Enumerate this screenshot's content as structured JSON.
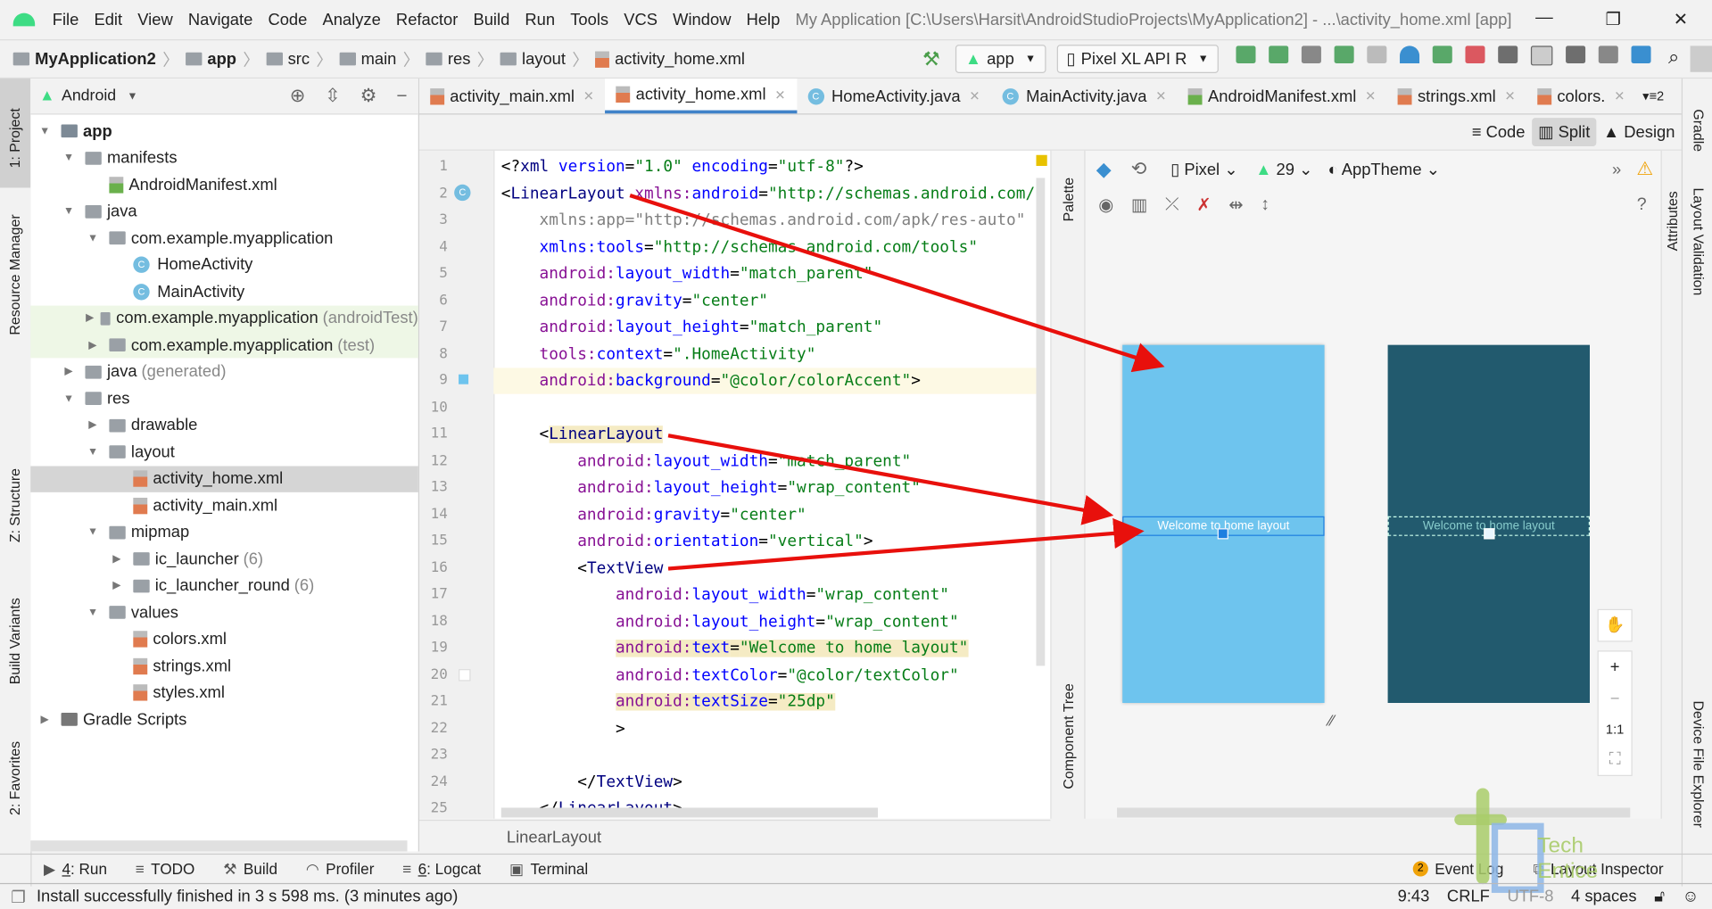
{
  "menu": {
    "items": [
      "File",
      "Edit",
      "View",
      "Navigate",
      "Code",
      "Analyze",
      "Refactor",
      "Build",
      "Run",
      "Tools",
      "VCS",
      "Window",
      "Help"
    ],
    "title": "My Application [C:\\Users\\Harsit\\AndroidStudioProjects\\MyApplication2] - ...\\activity_home.xml [app]"
  },
  "breadcrumb": [
    "MyApplication2",
    "app",
    "src",
    "main",
    "res",
    "layout",
    "activity_home.xml"
  ],
  "toolbar": {
    "run_config": "app",
    "device": "Pixel XL API R"
  },
  "project": {
    "view": "Android",
    "tree": [
      {
        "label": "app",
        "level": 0,
        "arrow": "down",
        "bold": true
      },
      {
        "label": "manifests",
        "level": 1,
        "arrow": "down"
      },
      {
        "label": "AndroidManifest.xml",
        "level": 2,
        "icon": "manifest"
      },
      {
        "label": "java",
        "level": 1,
        "arrow": "down"
      },
      {
        "label": "com.example.myapplication",
        "level": 2,
        "arrow": "down"
      },
      {
        "label": "HomeActivity",
        "level": 3,
        "icon": "class"
      },
      {
        "label": "MainActivity",
        "level": 3,
        "icon": "class"
      },
      {
        "label": "com.example.myapplication",
        "suffix": "(androidTest)",
        "level": 2,
        "arrow": "right",
        "test": true
      },
      {
        "label": "com.example.myapplication",
        "suffix": "(test)",
        "level": 2,
        "arrow": "right",
        "test": true
      },
      {
        "label": "java",
        "suffix": "(generated)",
        "level": 1,
        "arrow": "right"
      },
      {
        "label": "res",
        "level": 1,
        "arrow": "down"
      },
      {
        "label": "drawable",
        "level": 2,
        "arrow": "right"
      },
      {
        "label": "layout",
        "level": 2,
        "arrow": "down"
      },
      {
        "label": "activity_home.xml",
        "level": 3,
        "icon": "xml",
        "selected": true
      },
      {
        "label": "activity_main.xml",
        "level": 3,
        "icon": "xml"
      },
      {
        "label": "mipmap",
        "level": 2,
        "arrow": "down"
      },
      {
        "label": "ic_launcher",
        "suffix": "(6)",
        "level": 3,
        "arrow": "right"
      },
      {
        "label": "ic_launcher_round",
        "suffix": "(6)",
        "level": 3,
        "arrow": "right"
      },
      {
        "label": "values",
        "level": 2,
        "arrow": "down"
      },
      {
        "label": "colors.xml",
        "level": 3,
        "icon": "xml"
      },
      {
        "label": "strings.xml",
        "level": 3,
        "icon": "xml"
      },
      {
        "label": "styles.xml",
        "level": 3,
        "icon": "xml"
      },
      {
        "label": "Gradle Scripts",
        "level": 0,
        "arrow": "right"
      }
    ]
  },
  "left_tools": [
    "1: Project",
    "Resource Manager",
    "Z: Structure",
    "Build Variants",
    "2: Favorites"
  ],
  "right_tools": [
    "Gradle",
    "Layout Validation",
    "Device File Explorer"
  ],
  "tabs": [
    {
      "label": "activity_main.xml",
      "icon": "xml"
    },
    {
      "label": "activity_home.xml",
      "icon": "xml",
      "active": true
    },
    {
      "label": "HomeActivity.java",
      "icon": "class"
    },
    {
      "label": "MainActivity.java",
      "icon": "class"
    },
    {
      "label": "AndroidManifest.xml",
      "icon": "manifest"
    },
    {
      "label": "strings.xml",
      "icon": "xml"
    },
    {
      "label": "colors.",
      "icon": "xml"
    }
  ],
  "tabs_overflow": "2",
  "view_modes": {
    "code": "Code",
    "split": "Split",
    "design": "Design",
    "active": "Split"
  },
  "code_lines": [
    [
      [
        "pl",
        "<?"
      ],
      [
        "tag",
        "xml "
      ],
      [
        "an",
        "version"
      ],
      [
        "pl",
        "="
      ],
      [
        "av",
        "\"1.0\" "
      ],
      [
        "an",
        "encoding"
      ],
      [
        "pl",
        "="
      ],
      [
        "av",
        "\"utf-8\""
      ],
      [
        "pl",
        "?>"
      ]
    ],
    [
      [
        "pl",
        "<"
      ],
      [
        "tag",
        "LinearLayout "
      ],
      [
        "ns",
        "xmlns:"
      ],
      [
        "an",
        "android"
      ],
      [
        "pl",
        "="
      ],
      [
        "av",
        "\"http://schemas.android.com/"
      ]
    ],
    [
      [
        "dim",
        "    xmlns:app=\"http://schemas.android.com/apk/res-auto\""
      ]
    ],
    [
      [
        "pl",
        "    "
      ],
      [
        "an",
        "xmlns:tools"
      ],
      [
        "pl",
        "="
      ],
      [
        "av",
        "\"http://schemas.android.com/tools\""
      ]
    ],
    [
      [
        "pl",
        "    "
      ],
      [
        "ns",
        "android:"
      ],
      [
        "an",
        "layout_width"
      ],
      [
        "pl",
        "="
      ],
      [
        "av",
        "\"match_parent\""
      ]
    ],
    [
      [
        "pl",
        "    "
      ],
      [
        "ns",
        "android:"
      ],
      [
        "an",
        "gravity"
      ],
      [
        "pl",
        "="
      ],
      [
        "av",
        "\"center\""
      ]
    ],
    [
      [
        "pl",
        "    "
      ],
      [
        "ns",
        "android:"
      ],
      [
        "an",
        "layout_height"
      ],
      [
        "pl",
        "="
      ],
      [
        "av",
        "\"match_parent\""
      ]
    ],
    [
      [
        "pl",
        "    "
      ],
      [
        "ns",
        "tools:"
      ],
      [
        "an",
        "context"
      ],
      [
        "pl",
        "="
      ],
      [
        "av",
        "\".HomeActivity\""
      ]
    ],
    [
      [
        "pl",
        "    "
      ],
      [
        "ns",
        "android:"
      ],
      [
        "an",
        "background"
      ],
      [
        "pl",
        "="
      ],
      [
        "av",
        "\"@color/colorAccent\""
      ],
      [
        "pl",
        ">"
      ]
    ],
    [],
    [
      [
        "pl",
        "    <"
      ],
      [
        "tag",
        "LinearLayout"
      ]
    ],
    [
      [
        "pl",
        "        "
      ],
      [
        "ns",
        "android:"
      ],
      [
        "an",
        "layout_width"
      ],
      [
        "pl",
        "="
      ],
      [
        "av",
        "\"match_parent\""
      ]
    ],
    [
      [
        "pl",
        "        "
      ],
      [
        "ns",
        "android:"
      ],
      [
        "an",
        "layout_height"
      ],
      [
        "pl",
        "="
      ],
      [
        "av",
        "\"wrap_content\""
      ]
    ],
    [
      [
        "pl",
        "        "
      ],
      [
        "ns",
        "android:"
      ],
      [
        "an",
        "gravity"
      ],
      [
        "pl",
        "="
      ],
      [
        "av",
        "\"center\""
      ]
    ],
    [
      [
        "pl",
        "        "
      ],
      [
        "ns",
        "android:"
      ],
      [
        "an",
        "orientation"
      ],
      [
        "pl",
        "="
      ],
      [
        "av",
        "\"vertical\""
      ],
      [
        "pl",
        ">"
      ]
    ],
    [
      [
        "pl",
        "        <"
      ],
      [
        "tag",
        "TextView"
      ]
    ],
    [
      [
        "pl",
        "            "
      ],
      [
        "ns",
        "android:"
      ],
      [
        "an",
        "layout_width"
      ],
      [
        "pl",
        "="
      ],
      [
        "av",
        "\"wrap_content\""
      ]
    ],
    [
      [
        "pl",
        "            "
      ],
      [
        "ns",
        "android:"
      ],
      [
        "an",
        "layout_height"
      ],
      [
        "pl",
        "="
      ],
      [
        "av",
        "\"wrap_content\""
      ]
    ],
    [
      [
        "pl",
        "            "
      ],
      [
        "ns",
        "android:"
      ],
      [
        "an",
        "text"
      ],
      [
        "pl",
        "="
      ],
      [
        "av",
        "\"Welcome to home layout\""
      ]
    ],
    [
      [
        "pl",
        "            "
      ],
      [
        "ns",
        "android:"
      ],
      [
        "an",
        "textColor"
      ],
      [
        "pl",
        "="
      ],
      [
        "av",
        "\"@color/textColor\""
      ]
    ],
    [
      [
        "pl",
        "            "
      ],
      [
        "ns",
        "android:"
      ],
      [
        "an",
        "textSize"
      ],
      [
        "pl",
        "="
      ],
      [
        "av",
        "\"25dp\""
      ]
    ],
    [
      [
        "pl",
        "            >"
      ]
    ],
    [],
    [
      [
        "pl",
        "        </"
      ],
      [
        "tag",
        "TextView"
      ],
      [
        "pl",
        ">"
      ]
    ],
    [
      [
        "pl",
        "    </"
      ],
      [
        "tag",
        "LinearLayout"
      ],
      [
        "pl",
        ">"
      ]
    ]
  ],
  "editor_breadcrumb": "LinearLayout",
  "design": {
    "device": "Pixel",
    "api": "29",
    "theme": "AppTheme",
    "preview_text": "Welcome to home layout",
    "zoom_fit": "1:1",
    "palette": "Palette",
    "component_tree": "Component Tree",
    "attributes": "Attributes",
    "colors": {
      "design": "#6ec4ee",
      "blueprint": "#225a6e"
    }
  },
  "bottom_tools": [
    {
      "key": "4",
      "label": ": Run"
    },
    {
      "label": "TODO"
    },
    {
      "label": "Build"
    },
    {
      "label": "Profiler"
    },
    {
      "key": "6",
      "label": ": Logcat"
    },
    {
      "label": "Terminal"
    }
  ],
  "event_log": {
    "count": "2",
    "label": "Event Log"
  },
  "layout_inspector": "Layout Inspector",
  "watermark": "Tech Entice",
  "status": {
    "message": "Install successfully finished in 3 s 598 ms. (3 minutes ago)",
    "position": "9:43",
    "line_sep": "CRLF",
    "encoding": "UTF-8",
    "indent": "4 spaces"
  }
}
